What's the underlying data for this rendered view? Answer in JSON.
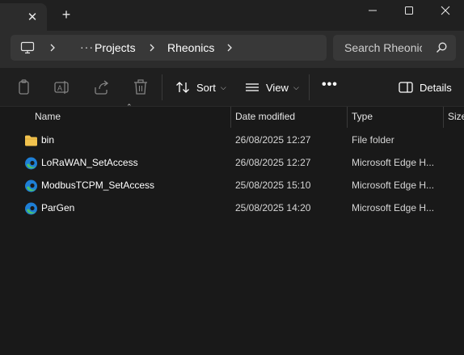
{
  "titlebar": {
    "tab_close_glyph": "✕",
    "new_tab_glyph": "+"
  },
  "address": {
    "ellipsis": "···",
    "crumbs": [
      "Projects",
      "Rheonics"
    ]
  },
  "search": {
    "placeholder": "Search Rheonics"
  },
  "toolbar": {
    "sort_label": "Sort",
    "view_label": "View",
    "more_label": "•••",
    "details_label": "Details"
  },
  "columns": {
    "name": "Name",
    "date_modified": "Date modified",
    "type": "Type",
    "size": "Size"
  },
  "files": [
    {
      "name": "bin",
      "date": "26/08/2025 12:27",
      "type": "File folder",
      "icon": "folder-icon"
    },
    {
      "name": "LoRaWAN_SetAccess",
      "date": "26/08/2025 12:27",
      "type": "Microsoft Edge H...",
      "icon": "edge-icon"
    },
    {
      "name": "ModbusTCPM_SetAccess",
      "date": "25/08/2025 15:10",
      "type": "Microsoft Edge H...",
      "icon": "edge-icon"
    },
    {
      "name": "ParGen",
      "date": "25/08/2025 14:20",
      "type": "Microsoft Edge H...",
      "icon": "edge-icon"
    }
  ],
  "colors": {
    "background": "#191919",
    "folder": "#f2c34e",
    "edge_blue": "#1e7fd6",
    "edge_green": "#4cc16b"
  }
}
